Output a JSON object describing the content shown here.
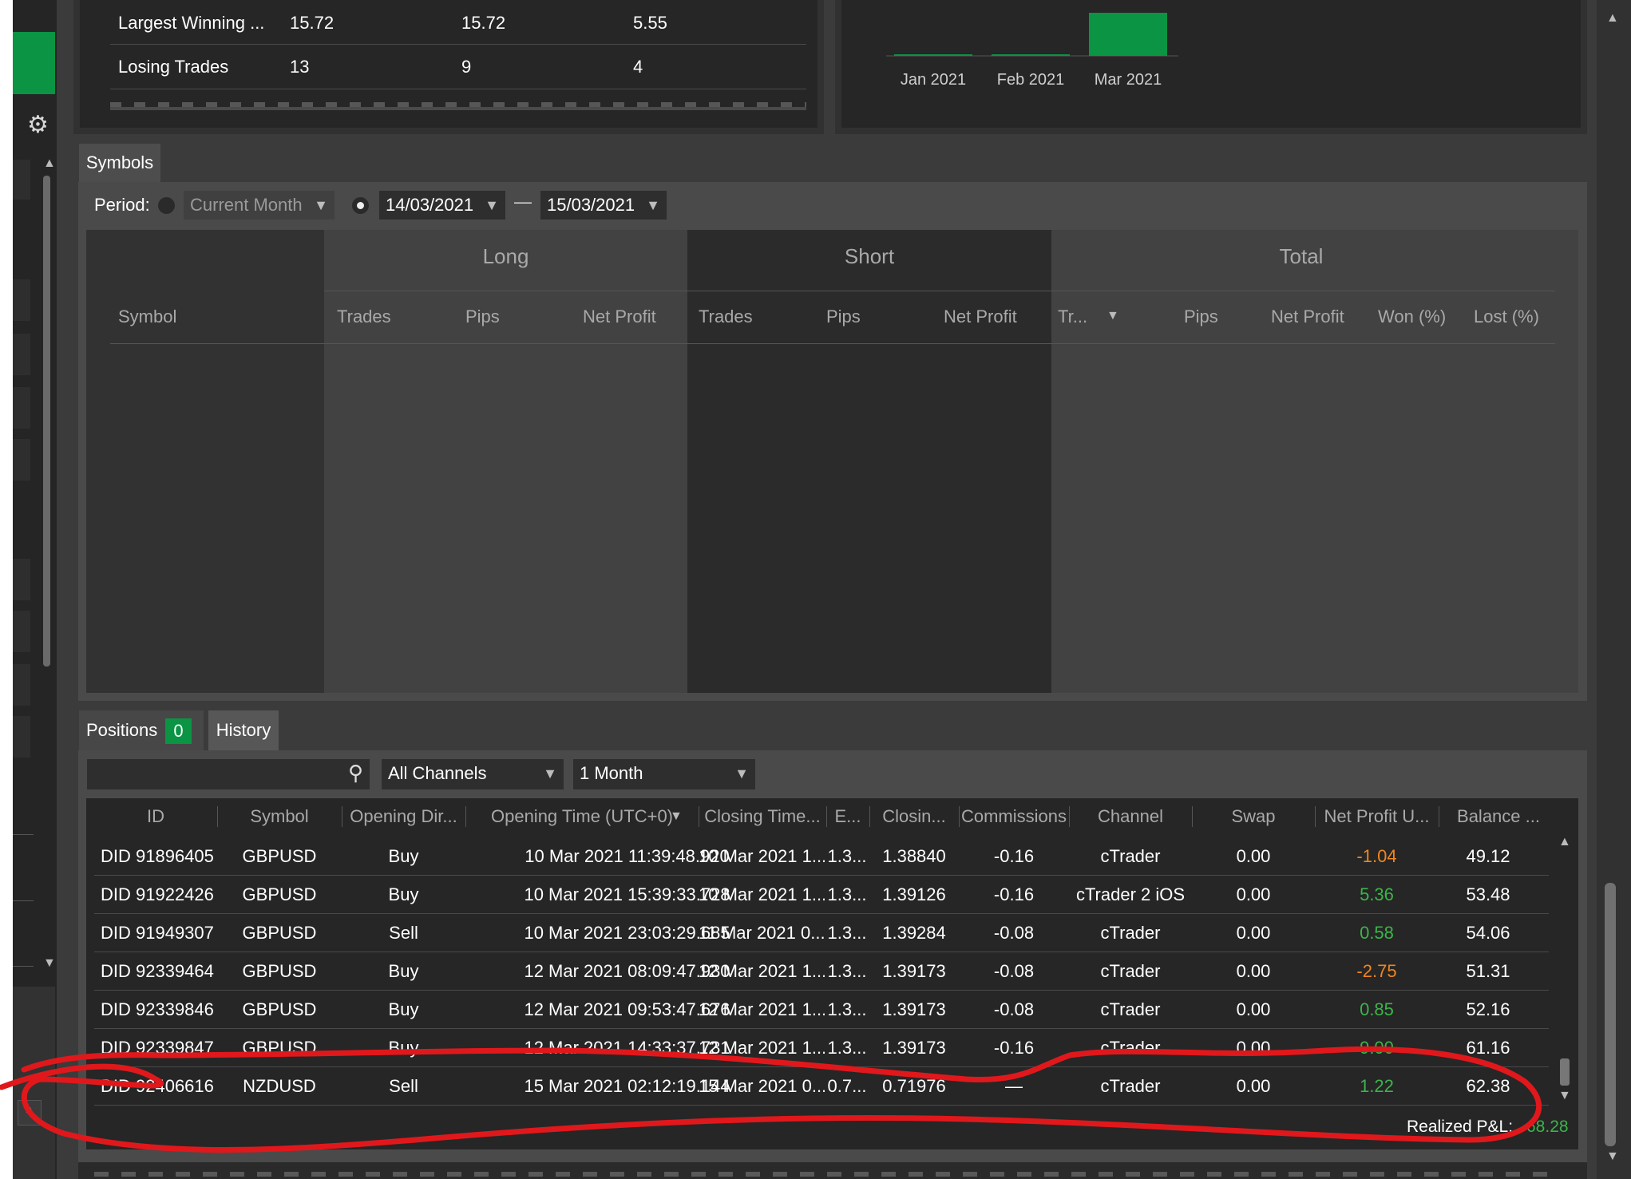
{
  "stats": {
    "rows": [
      {
        "label": "Largest Winning ...",
        "total": "15.72",
        "long": "15.72",
        "short": "5.55"
      },
      {
        "label": "Losing Trades",
        "total": "13",
        "long": "9",
        "short": "4"
      }
    ]
  },
  "monthly_chart": {
    "chart_data": {
      "type": "bar",
      "categories": [
        "Jan 2021",
        "Feb 2021",
        "Mar 2021"
      ],
      "values": [
        0.3,
        1.1,
        68.28
      ],
      "xlabel": "",
      "ylabel": "",
      "bar_color": "#0a9443"
    }
  },
  "symbols_panel": {
    "tab_label": "Symbols",
    "period_label": "Period:",
    "period_dropdown": "Current Month",
    "date_from": "14/03/2021",
    "date_separator": "—",
    "date_to": "15/03/2021",
    "groups": {
      "long": "Long",
      "short": "Short",
      "total": "Total"
    },
    "columns": {
      "symbol": "Symbol",
      "long_trades": "Trades",
      "long_pips": "Pips",
      "long_net": "Net Profit",
      "short_trades": "Trades",
      "short_pips": "Pips",
      "short_net": "Net Profit",
      "total_trades": "Tr...",
      "total_pips": "Pips",
      "total_net": "Net Profit",
      "won": "Won (%)",
      "lost": "Lost (%)"
    }
  },
  "bottom_tabs": {
    "positions_label": "Positions",
    "positions_count": "0",
    "history_label": "History"
  },
  "history": {
    "channels_dropdown": "All Channels",
    "period_dropdown": "1 Month",
    "columns": {
      "id": "ID",
      "symbol": "Symbol",
      "opening_dir": "Opening Dir...",
      "opening_time": "Opening Time (UTC+0)",
      "closing_time": "Closing Time...",
      "entry": "E...",
      "closing_price": "Closin...",
      "commissions": "Commissions",
      "channel": "Channel",
      "swap": "Swap",
      "net_profit": "Net Profit U...",
      "balance": "Balance ..."
    },
    "rows": [
      {
        "id": "DID 91896405",
        "symbol": "GBPUSD",
        "dir": "Buy",
        "open_time": "10 Mar 2021 11:39:48.920",
        "close_time": "10 Mar 2021 1...",
        "entry": "1.3...",
        "close_price": "1.38840",
        "comm": "-0.16",
        "channel": "cTrader",
        "swap": "0.00",
        "net": "-1.04",
        "net_color": "#f0861f",
        "balance": "49.12"
      },
      {
        "id": "DID 91922426",
        "symbol": "GBPUSD",
        "dir": "Buy",
        "open_time": "10 Mar 2021 15:39:33.728",
        "close_time": "10 Mar 2021 1...",
        "entry": "1.3...",
        "close_price": "1.39126",
        "comm": "-0.16",
        "channel": "cTrader 2 iOS",
        "swap": "0.00",
        "net": "5.36",
        "net_color": "#3bb54a",
        "balance": "53.48"
      },
      {
        "id": "DID 91949307",
        "symbol": "GBPUSD",
        "dir": "Sell",
        "open_time": "10 Mar 2021 23:03:29.685",
        "close_time": "11 Mar 2021 0...",
        "entry": "1.3...",
        "close_price": "1.39284",
        "comm": "-0.08",
        "channel": "cTrader",
        "swap": "0.00",
        "net": "0.58",
        "net_color": "#3bb54a",
        "balance": "54.06"
      },
      {
        "id": "DID 92339464",
        "symbol": "GBPUSD",
        "dir": "Buy",
        "open_time": "12 Mar 2021 08:09:47.930",
        "close_time": "12 Mar 2021 1...",
        "entry": "1.3...",
        "close_price": "1.39173",
        "comm": "-0.08",
        "channel": "cTrader",
        "swap": "0.00",
        "net": "-2.75",
        "net_color": "#f0861f",
        "balance": "51.31"
      },
      {
        "id": "DID 92339846",
        "symbol": "GBPUSD",
        "dir": "Buy",
        "open_time": "12 Mar 2021 09:53:47.676",
        "close_time": "12 Mar 2021 1...",
        "entry": "1.3...",
        "close_price": "1.39173",
        "comm": "-0.08",
        "channel": "cTrader",
        "swap": "0.00",
        "net": "0.85",
        "net_color": "#3bb54a",
        "balance": "52.16"
      },
      {
        "id": "DID 92339847",
        "symbol": "GBPUSD",
        "dir": "Buy",
        "open_time": "12 Mar 2021 14:33:37.731",
        "close_time": "12 Mar 2021 1...",
        "entry": "1.3...",
        "close_price": "1.39173",
        "comm": "-0.16",
        "channel": "cTrader",
        "swap": "0.00",
        "net": "9.00",
        "net_color": "#3bb54a",
        "balance": "61.16"
      },
      {
        "id": "DID 92406616",
        "symbol": "NZDUSD",
        "dir": "Sell",
        "open_time": "15 Mar 2021 02:12:19.144",
        "close_time": "15 Mar 2021 0...",
        "entry": "0.7...",
        "close_price": "0.71976",
        "comm": "—",
        "channel": "cTrader",
        "swap": "0.00",
        "net": "1.22",
        "net_color": "#3bb54a",
        "balance": "62.38"
      }
    ],
    "realized_label": "Realized P&L:",
    "realized_value": "68.28"
  },
  "colors": {
    "accent_green": "#0a9443",
    "profit_green": "#3bb54a",
    "loss_orange": "#f0861f",
    "annotation_red": "#e0181c"
  }
}
